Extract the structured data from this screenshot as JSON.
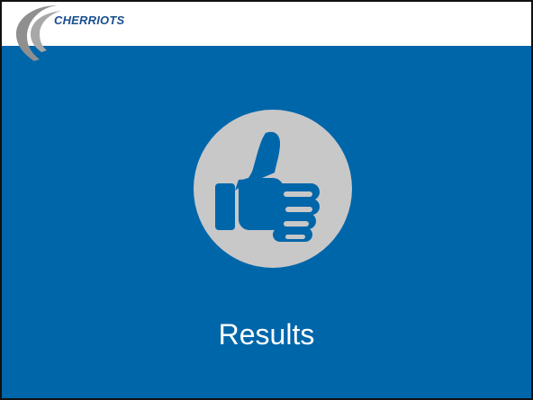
{
  "header": {
    "logo_text": "CHERRIOTS"
  },
  "slide": {
    "title": "Results",
    "icon": "thumbs-up-icon"
  },
  "colors": {
    "background": "#0066aa",
    "icon_circle": "#c8c8c8",
    "logo_text": "#1a4f8f",
    "logo_mark": "#8f8f8f"
  }
}
